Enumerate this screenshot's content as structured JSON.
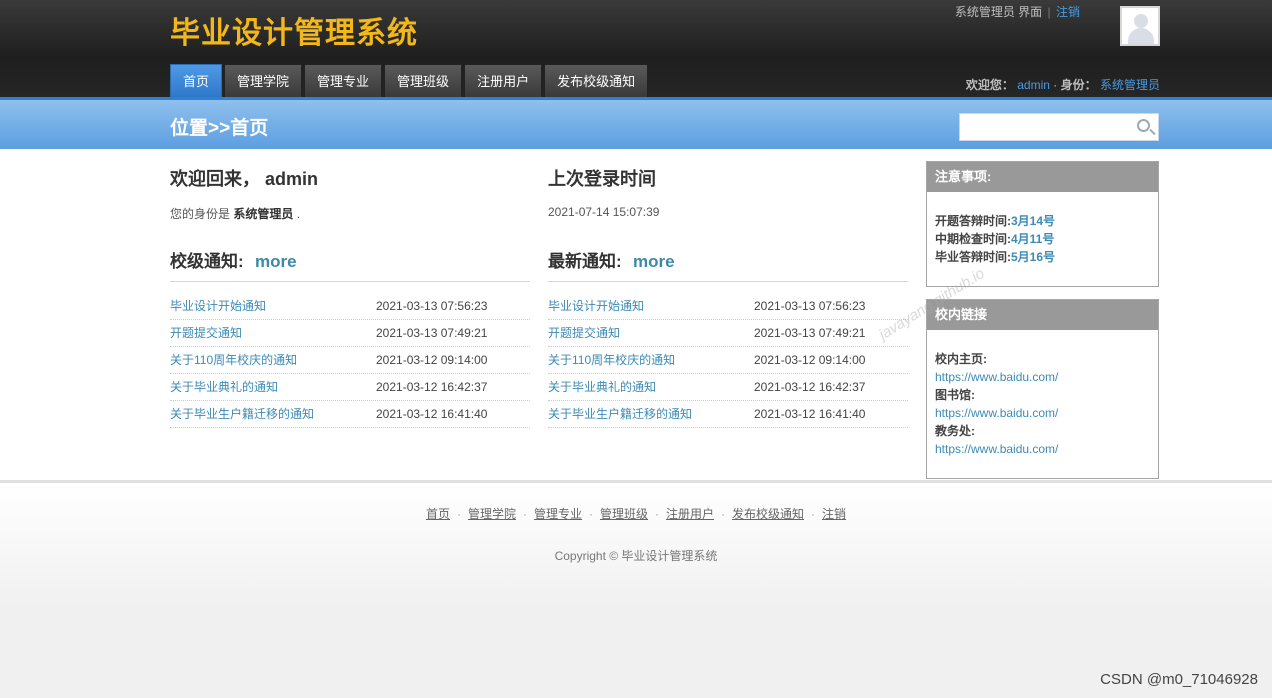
{
  "header": {
    "site_title": "毕业设计管理系统",
    "user_role_text": "系统管理员 界面",
    "logout": "注销",
    "welcome_prefix": "欢迎您：",
    "username": "admin",
    "role_prefix": "身份：",
    "role": "系统管理员"
  },
  "nav": {
    "items": [
      "首页",
      "管理学院",
      "管理专业",
      "管理班级",
      "注册用户",
      "发布校级通知"
    ]
  },
  "bar": {
    "location": "位置>>首页",
    "search_placeholder": ""
  },
  "welcome": {
    "title": "欢迎回来， admin",
    "identity_prefix": "您的身份是",
    "identity": "系统管理员",
    "identity_suffix": "."
  },
  "last_login": {
    "title": "上次登录时间",
    "time": "2021-07-14 15:07:39"
  },
  "school_notices": {
    "title": "校级通知:",
    "more": "more",
    "items": [
      {
        "title": "毕业设计开始通知",
        "date": "2021-03-13 07:56:23"
      },
      {
        "title": "开题提交通知",
        "date": "2021-03-13 07:49:21"
      },
      {
        "title": "关于110周年校庆的通知",
        "date": "2021-03-12 09:14:00"
      },
      {
        "title": "关于毕业典礼的通知",
        "date": "2021-03-12 16:42:37"
      },
      {
        "title": "关于毕业生户籍迁移的通知",
        "date": "2021-03-12 16:41:40"
      }
    ]
  },
  "latest_notices": {
    "title": "最新通知:",
    "more": "more",
    "items": [
      {
        "title": "毕业设计开始通知",
        "date": "2021-03-13 07:56:23"
      },
      {
        "title": "开题提交通知",
        "date": "2021-03-13 07:49:21"
      },
      {
        "title": "关于110周年校庆的通知",
        "date": "2021-03-12 09:14:00"
      },
      {
        "title": "关于毕业典礼的通知",
        "date": "2021-03-12 16:42:37"
      },
      {
        "title": "关于毕业生户籍迁移的通知",
        "date": "2021-03-12 16:41:40"
      }
    ]
  },
  "notes": {
    "title": "注意事项:",
    "items": [
      {
        "label": "开题答辩时间:",
        "value": "3月14号"
      },
      {
        "label": "中期检查时间:",
        "value": "4月11号"
      },
      {
        "label": "毕业答辩时间:",
        "value": "5月16号"
      }
    ]
  },
  "links": {
    "title": "校内链接",
    "items": [
      {
        "label": "校内主页:",
        "url": "https://www.baidu.com/"
      },
      {
        "label": "图书馆:",
        "url": "https://www.baidu.com/"
      },
      {
        "label": "教务处:",
        "url": "https://www.baidu.com/"
      }
    ]
  },
  "footer": {
    "links": [
      "首页",
      "管理学院",
      "管理专业",
      "管理班级",
      "注册用户",
      "发布校级通知",
      "注销"
    ],
    "separator": "·",
    "copyright": "Copyright © 毕业设计管理系统"
  },
  "watermark": "javayang.github.io",
  "csdn": "CSDN @m0_71046928"
}
